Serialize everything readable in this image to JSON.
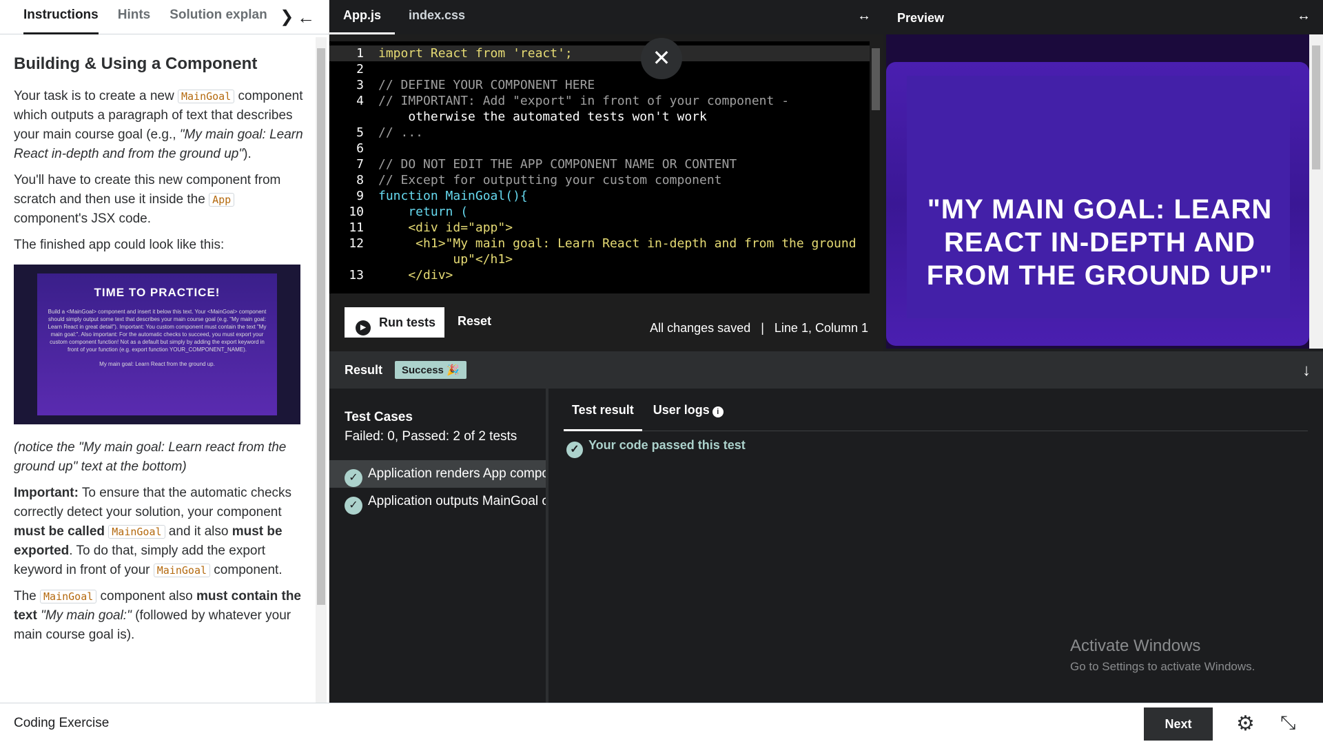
{
  "left": {
    "tabs": [
      "Instructions",
      "Hints",
      "Solution explan"
    ],
    "title": "Building & Using a Component",
    "p1a": "Your task is to create a new ",
    "code_main": "MainGoal",
    "p1b": " component which outputs a paragraph of text that describes your main course goal (e.g., ",
    "p1c": "\"My main goal: Learn React in-depth and from the ground up\"",
    "p1d": ").",
    "p2a": "You'll have to create this new component from scratch and then use it inside the ",
    "code_app": "App",
    "p2b": " component's JSX code.",
    "p3": "The finished app could look like this:",
    "thumb_title": "TIME TO PRACTICE!",
    "thumb_text": "Build a <MainGoal> component and insert it below this text. Your <MainGoal> component should simply output some text that describes your main course goal (e.g. \"My main goal: Learn React in great detail\"). Important: You custom component must contain the text \"My main goal:\". Also important: For the automatic checks to succeed, you must export your custom component function! Not as a default but simply by adding the export keyword in front of your function (e.g. export function YOUR_COMPONENT_NAME).",
    "thumb_goal": "My main goal: Learn React from the ground up.",
    "note": "(notice the \"My main goal: Learn react from the ground up\" text at the bottom)",
    "imp_label": "Important:",
    "imp1": " To ensure that the automatic checks correctly detect your solution, your component ",
    "imp_b1": "must be called",
    "imp2": " and it also ",
    "imp_b2": "must be exported",
    "imp3": ". To do that, simply add the export keyword in front of your ",
    "imp4": " component.",
    "last1": "The ",
    "last2": " component also ",
    "last_b": "must contain the text",
    "last_i": " \"My main goal:\"",
    "last3": " (followed by whatever your main course goal is)."
  },
  "editor": {
    "tabs": [
      "App.js",
      "index.css"
    ],
    "lines": [
      {
        "n": "1",
        "t": "import React from 'react';"
      },
      {
        "n": "2",
        "t": ""
      },
      {
        "n": "3",
        "t": "// DEFINE YOUR COMPONENT HERE"
      },
      {
        "n": "4",
        "t": "// IMPORTANT: Add \"export\" in front of your component -"
      },
      {
        "n": "",
        "t": "    otherwise the automated tests won't work"
      },
      {
        "n": "5",
        "t": "// ..."
      },
      {
        "n": "6",
        "t": ""
      },
      {
        "n": "7",
        "t": "// DO NOT EDIT THE APP COMPONENT NAME OR CONTENT"
      },
      {
        "n": "8",
        "t": "// Except for outputting your custom component"
      },
      {
        "n": "9",
        "t": "function MainGoal(){"
      },
      {
        "n": "10",
        "t": "    return ("
      },
      {
        "n": "11",
        "t": "    <div id=\"app\">"
      },
      {
        "n": "12",
        "t": "     <h1>\"My main goal: Learn React in-depth and from the ground"
      },
      {
        "n": "",
        "t": "          up\"</h1>"
      },
      {
        "n": "13",
        "t": "    </div>"
      }
    ],
    "run_label": "Run tests",
    "reset_label": "Reset",
    "saved": "All changes saved",
    "position": "Line 1, Column 1"
  },
  "preview": {
    "title": "Preview",
    "goal": "\"MY MAIN GOAL: LEARN REACT IN-DEPTH AND FROM THE GROUND UP\""
  },
  "result": {
    "label": "Result",
    "badge": "Success 🎉",
    "cases_title": "Test Cases",
    "cases_summary": "Failed: 0, Passed: 2 of 2 tests",
    "cases": [
      "Application renders App component",
      "Application outputs MainGoal component"
    ],
    "tabs": [
      "Test result",
      "User logs"
    ],
    "passed": "Your code passed this test"
  },
  "watermark": {
    "line1": "Activate Windows",
    "line2": "Go to Settings to activate Windows."
  },
  "footer": {
    "label": "Coding Exercise",
    "next": "Next"
  }
}
